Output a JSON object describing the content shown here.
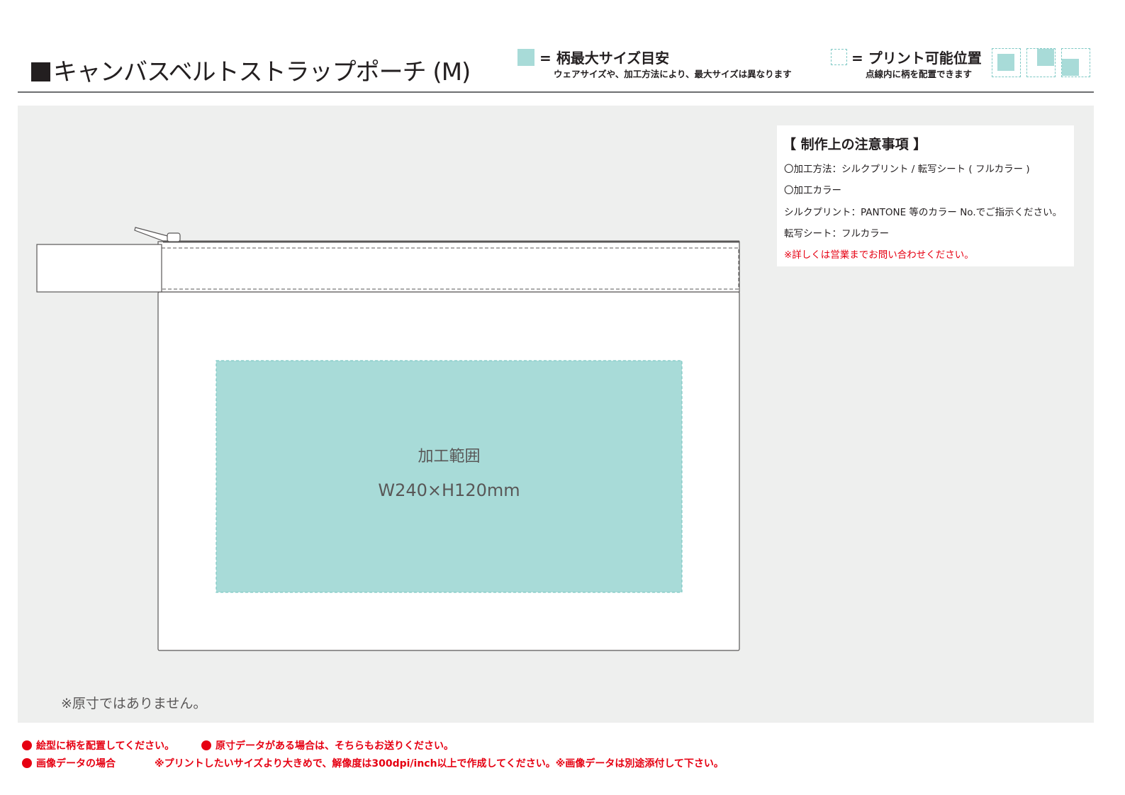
{
  "header": {
    "title": "キャンバスベルトストラップポーチ (M)"
  },
  "legend": {
    "max_size_main": "= 柄最大サイズ目安",
    "max_size_sub": "ウェアサイズや、加工方法により、最大サイズは異なります",
    "print_pos_main": "= プリント可能位置",
    "print_pos_sub": "点線内に柄を配置できます"
  },
  "notes": {
    "title": "【 制作上の注意事項 】",
    "lines": [
      "〇加工方法：シルクプリント / 転写シート ( フルカラー )",
      "〇加工カラー",
      "シルクプリント：PANTONE 等のカラー No.でご指示ください。",
      "転写シート：フルカラー",
      "※詳しくは営業までお問い合わせください。"
    ]
  },
  "print_area": {
    "label": "加工範囲",
    "size": "W240×H120mm"
  },
  "disclaimer": "※原寸ではありません。",
  "footer": {
    "item1": "絵型に柄を配置してください。",
    "item2": "原寸データがある場合は、そちらもお送りください。",
    "item3": "画像データの場合",
    "item3_detail": "※プリントしたいサイズより大きめで、解像度は300dpi/inch以上で作成してください。※画像データは別途添付して下さい。"
  },
  "colors": {
    "print_area_fill": "#a8dbd8",
    "print_area_border": "#7fc9c5",
    "background_panel": "#eeefee",
    "warning_red": "#e60012"
  }
}
